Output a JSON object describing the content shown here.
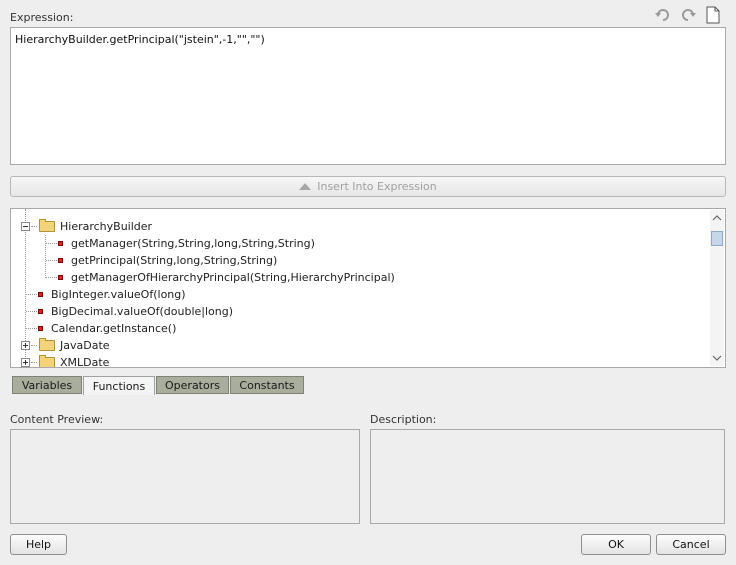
{
  "expression": {
    "label": "Expression:",
    "value": "HierarchyBuilder.getPrincipal(\"jstein\",-1,\"\",\"\")"
  },
  "toolbar": {
    "icons": [
      "undo-icon",
      "redo-icon",
      "new-document-icon"
    ]
  },
  "insert_button": {
    "label": "Insert Into Expression"
  },
  "tree": {
    "items": [
      {
        "label": "HierarchyBuilder",
        "kind": "folder",
        "expanded": true
      },
      {
        "label": "getManager(String,String,long,String,String)",
        "kind": "method"
      },
      {
        "label": "getPrincipal(String,long,String,String)",
        "kind": "method"
      },
      {
        "label": "getManagerOfHierarchyPrincipal(String,HierarchyPrincipal)",
        "kind": "method"
      },
      {
        "label": "BigInteger.valueOf(long)",
        "kind": "method"
      },
      {
        "label": "BigDecimal.valueOf(double|long)",
        "kind": "method"
      },
      {
        "label": "Calendar.getInstance()",
        "kind": "method"
      },
      {
        "label": "JavaDate",
        "kind": "folder",
        "expanded": false
      },
      {
        "label": "XMLDate",
        "kind": "folder",
        "expanded": false
      }
    ]
  },
  "tabs": [
    {
      "label": "Variables",
      "active": false
    },
    {
      "label": "Functions",
      "active": true
    },
    {
      "label": "Operators",
      "active": false
    },
    {
      "label": "Constants",
      "active": false
    }
  ],
  "content_preview": {
    "label": "Content Preview:"
  },
  "description": {
    "label": "Description:"
  },
  "buttons": {
    "help": "Help",
    "ok": "OK",
    "cancel": "Cancel"
  },
  "colors": {
    "background": "#eeeeee",
    "tab_inactive": "#a9ad9c",
    "method_icon": "#dd2222",
    "folder_icon": "#f2d37a"
  }
}
